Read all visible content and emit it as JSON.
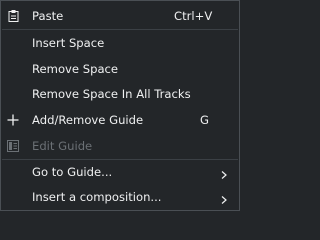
{
  "menu": {
    "items": [
      {
        "label": "Paste",
        "shortcut": "Ctrl+V",
        "icon": "paste-icon",
        "enabled": true
      },
      {
        "label": "Insert Space",
        "enabled": true
      },
      {
        "label": "Remove Space",
        "enabled": true
      },
      {
        "label": "Remove Space In All Tracks",
        "enabled": true
      },
      {
        "label": "Add/Remove Guide",
        "shortcut": "G",
        "icon": "plus-icon",
        "enabled": true
      },
      {
        "label": "Edit Guide",
        "icon": "edit-guide-icon",
        "enabled": false
      },
      {
        "label": "Go to Guide...",
        "submenu": true,
        "enabled": true
      },
      {
        "label": "Insert a composition...",
        "submenu": true,
        "enabled": true
      }
    ]
  },
  "colors": {
    "background": "#232629",
    "text": "#eff0f1",
    "disabled_text": "#6b7075",
    "border": "#4a4f54"
  }
}
